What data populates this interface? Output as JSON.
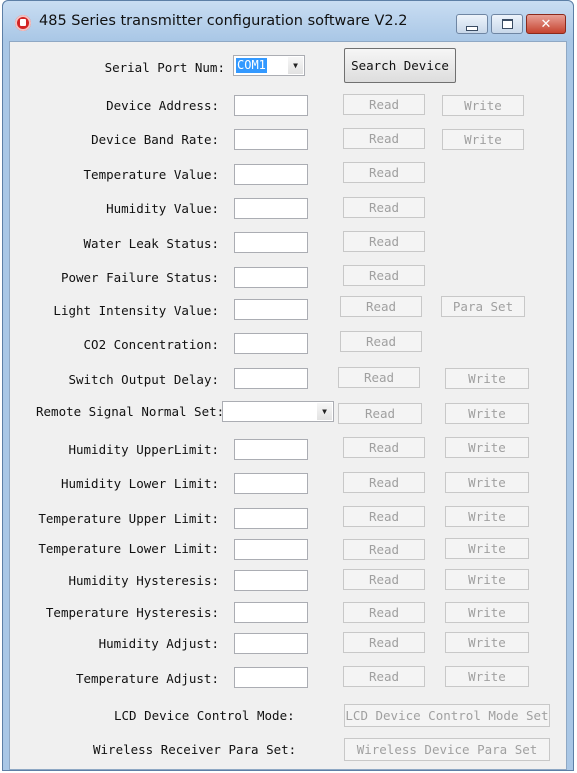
{
  "window": {
    "title": "485 Series transmitter configuration software V2.2",
    "controls": {
      "minimize": "minimize",
      "maximize": "maximize",
      "close": "✕"
    }
  },
  "serial": {
    "label": "Serial Port Num:",
    "value": "COM1",
    "search_button": "Search Device"
  },
  "rows": [
    {
      "label": "Device Address:",
      "read": "Read",
      "write": "Write"
    },
    {
      "label": "Device Band Rate:",
      "read": "Read",
      "write": "Write"
    },
    {
      "label": "Temperature Value:",
      "read": "Read"
    },
    {
      "label": "Humidity Value:",
      "read": "Read"
    },
    {
      "label": "Water Leak Status:",
      "read": "Read"
    },
    {
      "label": "Power Failure Status:",
      "read": "Read"
    },
    {
      "label": "Light Intensity Value:",
      "read": "Read",
      "write": "Para Set"
    },
    {
      "label": "CO2 Concentration:",
      "read": "Read"
    },
    {
      "label": "Switch Output Delay:",
      "read": "Read",
      "write": "Write"
    },
    {
      "label": "Remote Signal Normal Set:",
      "read": "Read",
      "write": "Write"
    },
    {
      "label": "Humidity UpperLimit:",
      "read": "Read",
      "write": "Write"
    },
    {
      "label": "Humidity Lower Limit:",
      "read": "Read",
      "write": "Write"
    },
    {
      "label": "Temperature Upper Limit:",
      "read": "Read",
      "write": "Write"
    },
    {
      "label": "Temperature Lower Limit:",
      "read": "Read",
      "write": "Write"
    },
    {
      "label": "Humidity Hysteresis:",
      "read": "Read",
      "write": "Write"
    },
    {
      "label": "Temperature Hysteresis:",
      "read": "Read",
      "write": "Write"
    },
    {
      "label": "Humidity Adjust:",
      "read": "Read",
      "write": "Write"
    },
    {
      "label": "Temperature Adjust:",
      "read": "Read",
      "write": "Write"
    }
  ],
  "bottom": {
    "lcd_label": "LCD Device Control Mode:",
    "lcd_button": "LCD Device Control Mode Set",
    "wireless_label": "Wireless Receiver Para Set:",
    "wireless_button": "Wireless Device Para Set"
  }
}
